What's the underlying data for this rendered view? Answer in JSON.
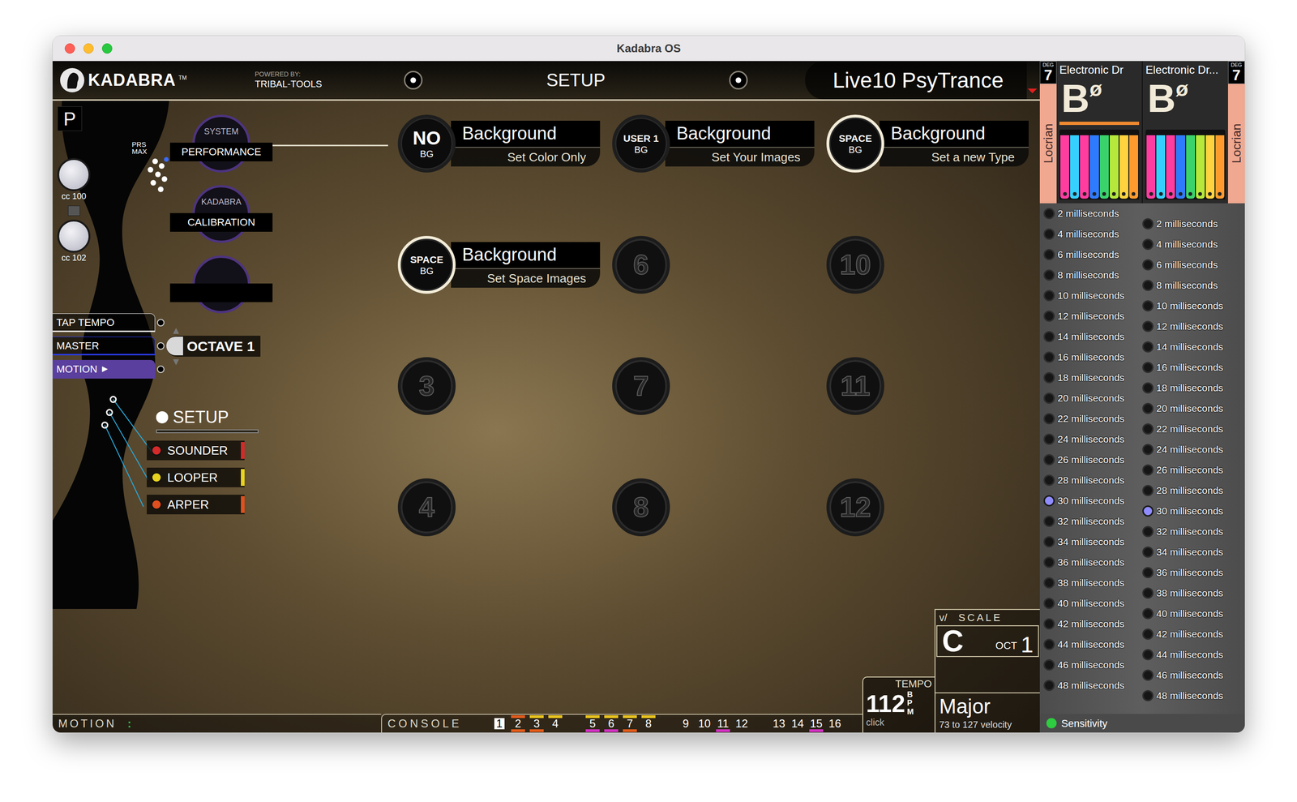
{
  "window": {
    "title": "Kadabra OS"
  },
  "header": {
    "brand": "KADABRA",
    "trademark": "TM",
    "powered_by": "POWERED BY:",
    "powered_name": "TRIBAL-TOOLS",
    "page": "SETUP",
    "preset": "Live10 PsyTrance"
  },
  "left_panel": {
    "badge": "P",
    "prs": "PRS",
    "max": "MAX",
    "knobs": [
      {
        "label": "cc 100"
      },
      {
        "label": "cc 102"
      }
    ],
    "system_buttons": [
      {
        "top": "SYSTEM",
        "label": "PERFORMANCE"
      },
      {
        "top": "KADABRA",
        "label": "CALIBRATION"
      },
      {
        "top": "",
        "label": ""
      }
    ],
    "controls": [
      {
        "label": "TAP TEMPO",
        "icon": "",
        "color": "#e8e8e8",
        "filled": false
      },
      {
        "label": "MASTER",
        "icon": "",
        "color": "#2a3cff",
        "filled": false
      },
      {
        "label": "MOTION",
        "icon": "▶",
        "color": "#5a3f9e",
        "filled": true
      }
    ],
    "octave": {
      "label": "OCTAVE 1",
      "up": "▲",
      "down": "▼"
    },
    "setup": {
      "label": "SETUP",
      "modules": [
        {
          "label": "SOUNDER",
          "color": "#d42a2a"
        },
        {
          "label": "LOOPER",
          "color": "#e8d21e"
        },
        {
          "label": "ARPER",
          "color": "#e0501e"
        }
      ]
    }
  },
  "grid": {
    "rows": [
      [
        {
          "kind": "preset",
          "top": "NO",
          "bottom": "BG",
          "title": "Background",
          "subtitle": "Set Color Only",
          "highlighted": false
        },
        {
          "kind": "preset",
          "top": "USER 1",
          "bottom": "BG",
          "title": "Background",
          "subtitle": "Set Your Images",
          "highlighted": false
        },
        {
          "kind": "preset",
          "top": "SPACE",
          "bottom": "BG",
          "title": "Background",
          "subtitle": "Set a new Type",
          "highlighted": true
        }
      ],
      [
        {
          "kind": "preset",
          "top": "SPACE",
          "bottom": "BG",
          "title": "Background",
          "subtitle": "Set Space Images",
          "highlighted": true
        },
        {
          "kind": "empty",
          "number": "6"
        },
        {
          "kind": "empty",
          "number": "10"
        }
      ],
      [
        {
          "kind": "empty",
          "number": "3"
        },
        {
          "kind": "empty",
          "number": "7"
        },
        {
          "kind": "empty",
          "number": "11"
        }
      ],
      [
        {
          "kind": "empty",
          "number": "4"
        },
        {
          "kind": "empty",
          "number": "8"
        },
        {
          "kind": "empty",
          "number": "12"
        }
      ]
    ]
  },
  "bottom_bar": {
    "motion": "MOTION",
    "motion_icon": ":",
    "console": "CONSOLE",
    "channels": [
      {
        "number": "1",
        "selected": true,
        "mark": null,
        "under": null
      },
      {
        "number": "2",
        "selected": false,
        "mark": "#e05a1a",
        "under": "#e05a1a"
      },
      {
        "number": "3",
        "selected": false,
        "mark": "#e8c21e",
        "under": "#e05a1a"
      },
      {
        "number": "4",
        "selected": false,
        "mark": "#e8c21e",
        "under": null
      },
      {
        "number": "5",
        "selected": false,
        "mark": "#e8c21e",
        "under": "#d030c0"
      },
      {
        "number": "6",
        "selected": false,
        "mark": "#e8c21e",
        "under": "#d030c0"
      },
      {
        "number": "7",
        "selected": false,
        "mark": "#e8c21e",
        "under": "#e05a1a"
      },
      {
        "number": "8",
        "selected": false,
        "mark": "#e8c21e",
        "under": null
      },
      {
        "number": "9",
        "selected": false,
        "mark": null,
        "under": null
      },
      {
        "number": "10",
        "selected": false,
        "mark": null,
        "under": null
      },
      {
        "number": "11",
        "selected": false,
        "mark": null,
        "under": "#d030c0"
      },
      {
        "number": "12",
        "selected": false,
        "mark": null,
        "under": null
      },
      {
        "number": "13",
        "selected": false,
        "mark": null,
        "under": null
      },
      {
        "number": "14",
        "selected": false,
        "mark": null,
        "under": null
      },
      {
        "number": "15",
        "selected": false,
        "mark": null,
        "under": "#d030c0"
      },
      {
        "number": "16",
        "selected": false,
        "mark": null,
        "under": null
      }
    ]
  },
  "tempo": {
    "label": "TEMPO",
    "value": "112",
    "unit": "BPM",
    "click": "click"
  },
  "scale": {
    "prefix": "v/",
    "label": "SCALE",
    "key": "C",
    "oct_label": "OCT",
    "oct": "1",
    "mode": "Major",
    "velocity": "73 to 127 velocity"
  },
  "decks": [
    {
      "name": "Electronic Dr",
      "deg_label": "DEG",
      "deg": "7",
      "note": "B",
      "symbol": "ø",
      "scale": "Locrian",
      "active": true,
      "keys": [
        "#ff3da0",
        "#35d0ff",
        "#ff3da0",
        "#2f7bff",
        "#3ad36b",
        "#b5e83b",
        "#ffd23f",
        "#ff9a2e"
      ]
    },
    {
      "name": "Electronic Dr...",
      "deg_label": "DEG",
      "deg": "7",
      "note": "B",
      "symbol": "ø",
      "scale": "Locrian",
      "active": false,
      "keys": [
        "#ff3da0",
        "#35d0ff",
        "#ff3da0",
        "#2f7bff",
        "#3ad36b",
        "#b5e83b",
        "#ffd23f",
        "#ff9a2e"
      ]
    }
  ],
  "delays": {
    "left": [
      {
        "label": "2 milliseconds",
        "selected": false
      },
      {
        "label": "4 milliseconds",
        "selected": false
      },
      {
        "label": "6 milliseconds",
        "selected": false
      },
      {
        "label": "8 milliseconds",
        "selected": false
      },
      {
        "label": "10 milliseconds",
        "selected": false
      },
      {
        "label": "12 milliseconds",
        "selected": false
      },
      {
        "label": "14 milliseconds",
        "selected": false
      },
      {
        "label": "16 milliseconds",
        "selected": false
      },
      {
        "label": "18 milliseconds",
        "selected": false
      },
      {
        "label": "20 milliseconds",
        "selected": false
      },
      {
        "label": "22 milliseconds",
        "selected": false
      },
      {
        "label": "24 milliseconds",
        "selected": false
      },
      {
        "label": "26 milliseconds",
        "selected": false
      },
      {
        "label": "28 milliseconds",
        "selected": false
      },
      {
        "label": "30 milliseconds",
        "selected": true
      },
      {
        "label": "32 milliseconds",
        "selected": false
      },
      {
        "label": "34 milliseconds",
        "selected": false
      },
      {
        "label": "36 milliseconds",
        "selected": false
      },
      {
        "label": "38 milliseconds",
        "selected": false
      },
      {
        "label": "40 milliseconds",
        "selected": false
      },
      {
        "label": "42 milliseconds",
        "selected": false
      },
      {
        "label": "44 milliseconds",
        "selected": false
      },
      {
        "label": "46 milliseconds",
        "selected": false
      },
      {
        "label": "48 milliseconds",
        "selected": false
      }
    ],
    "right": [
      {
        "label": "2 milliseconds",
        "selected": false
      },
      {
        "label": "4 milliseconds",
        "selected": false
      },
      {
        "label": "6 milliseconds",
        "selected": false
      },
      {
        "label": "8 milliseconds",
        "selected": false
      },
      {
        "label": "10 milliseconds",
        "selected": false
      },
      {
        "label": "12 milliseconds",
        "selected": false
      },
      {
        "label": "14 milliseconds",
        "selected": false
      },
      {
        "label": "16 milliseconds",
        "selected": false
      },
      {
        "label": "18 milliseconds",
        "selected": false
      },
      {
        "label": "20 milliseconds",
        "selected": false
      },
      {
        "label": "22 milliseconds",
        "selected": false
      },
      {
        "label": "24 milliseconds",
        "selected": false
      },
      {
        "label": "26 milliseconds",
        "selected": false
      },
      {
        "label": "28 milliseconds",
        "selected": false
      },
      {
        "label": "30 milliseconds",
        "selected": true
      },
      {
        "label": "32 milliseconds",
        "selected": false
      },
      {
        "label": "34 milliseconds",
        "selected": false
      },
      {
        "label": "36 milliseconds",
        "selected": false
      },
      {
        "label": "38 milliseconds",
        "selected": false
      },
      {
        "label": "40 milliseconds",
        "selected": false
      },
      {
        "label": "42 milliseconds",
        "selected": false
      },
      {
        "label": "44 milliseconds",
        "selected": false
      },
      {
        "label": "46 milliseconds",
        "selected": false
      },
      {
        "label": "48 milliseconds",
        "selected": false
      }
    ]
  },
  "sensitivity": {
    "label": "Sensitivity",
    "on": true
  }
}
